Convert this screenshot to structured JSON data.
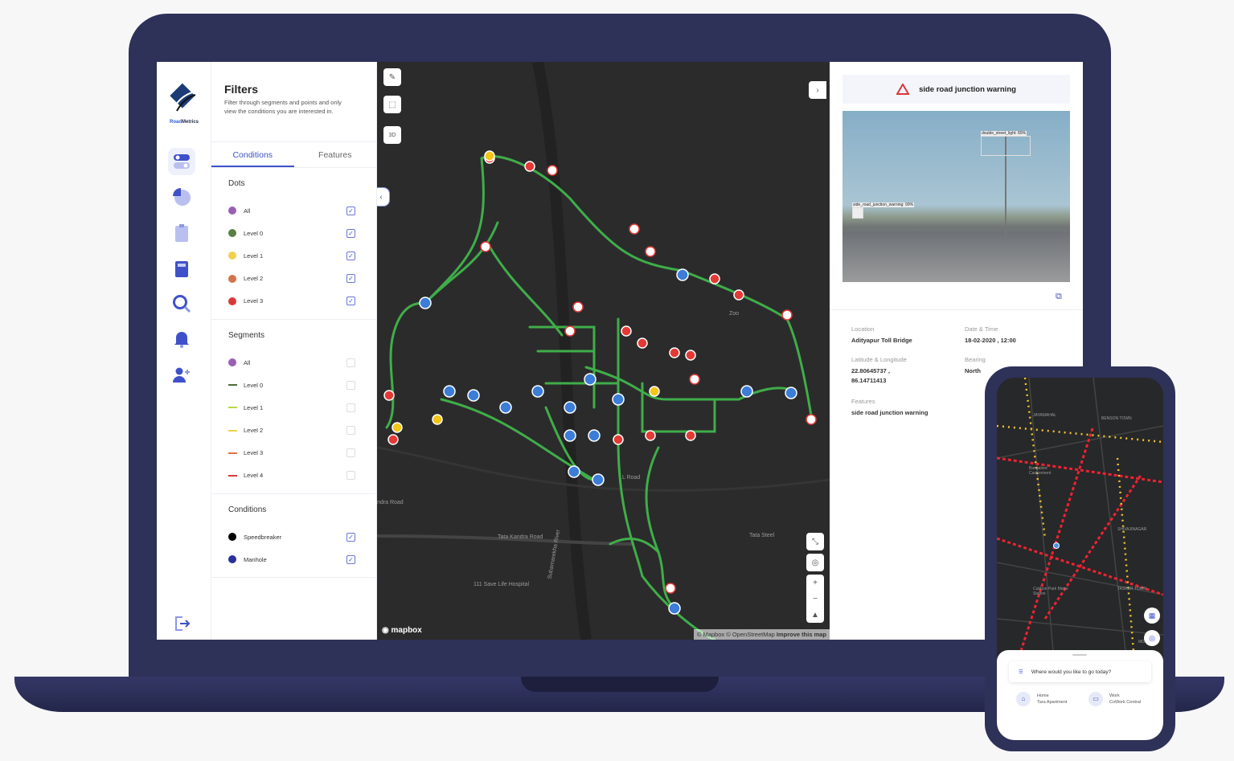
{
  "brand": {
    "name_a": "Road",
    "name_b": "Metrics"
  },
  "filters": {
    "title": "Filters",
    "description": "Filter through segments and points and only view the conditions you are interested in.",
    "tabs": [
      {
        "label": "Conditions",
        "active": true
      },
      {
        "label": "Features",
        "active": false
      }
    ],
    "dots": {
      "title": "Dots",
      "items": [
        {
          "label": "All",
          "color": "#9b5fb5",
          "checked": true
        },
        {
          "label": "Level 0",
          "color": "#5a8046",
          "checked": true
        },
        {
          "label": "Level 1",
          "color": "#f2d04b",
          "checked": true
        },
        {
          "label": "Level 2",
          "color": "#d2744a",
          "checked": true
        },
        {
          "label": "Level 3",
          "color": "#d9383a",
          "checked": true
        }
      ]
    },
    "segments": {
      "title": "Segments",
      "items": [
        {
          "label": "All",
          "color": "#9b5fb5",
          "checked": false,
          "kind": "dot"
        },
        {
          "label": "Level 0",
          "color": "#4d6e3c",
          "checked": false
        },
        {
          "label": "Level 1",
          "color": "#b9d94a",
          "checked": false
        },
        {
          "label": "Level 2",
          "color": "#f2d04b",
          "checked": false
        },
        {
          "label": "Level 3",
          "color": "#e0713f",
          "checked": false
        },
        {
          "label": "Level 4",
          "color": "#d9383a",
          "checked": false
        }
      ]
    },
    "conditions": {
      "title": "Conditions",
      "items": [
        {
          "label": "Speedbreaker",
          "color": "#000000",
          "checked": true
        },
        {
          "label": "Manhole",
          "color": "#2a2f9e",
          "checked": true
        }
      ]
    }
  },
  "map": {
    "labels": [
      "Tata Kandra Road",
      "111 Save Life Hospital",
      "Subarnarekha River",
      "Tata Steel",
      "Zoo",
      "L Road",
      "ndra Road"
    ],
    "logo": "mapbox",
    "attribution": "© Mapbox © OpenStreetMap",
    "improve": "Improve this map",
    "btn_3d": "3D"
  },
  "detail": {
    "title": "side road junction warning",
    "detections": [
      "double_street_light: 89%",
      "side_road_junction_warning: 99%"
    ],
    "fields": [
      {
        "key": "Location",
        "value": "Adityapur Toll Bridge"
      },
      {
        "key": "Date & Time",
        "value": "18-02-2020 , 12:00"
      },
      {
        "key": "Latitude & Longitude",
        "value": "22.80645737 ,",
        "value2": "86.14711413"
      },
      {
        "key": "Bearing",
        "value": "North"
      },
      {
        "key": "Features",
        "value": "side road junction warning"
      }
    ]
  },
  "phone": {
    "labels": [
      "JAYAMAHAL",
      "BENSON TOWN",
      "Bangalore Cantonment",
      "Cubbon Park Metro Station",
      "TASKER TOWN",
      "SHIVAJINAGAR",
      "MG Road"
    ],
    "search_placeholder": "Where would you like to go today?",
    "places": [
      {
        "name": "Home",
        "sub": "Tara Apartment"
      },
      {
        "name": "Work",
        "sub": "CoWork Central"
      }
    ]
  },
  "colors": {
    "accent": "#3f51c9",
    "frame": "#2e3158",
    "segment_green": "#3fae49"
  }
}
